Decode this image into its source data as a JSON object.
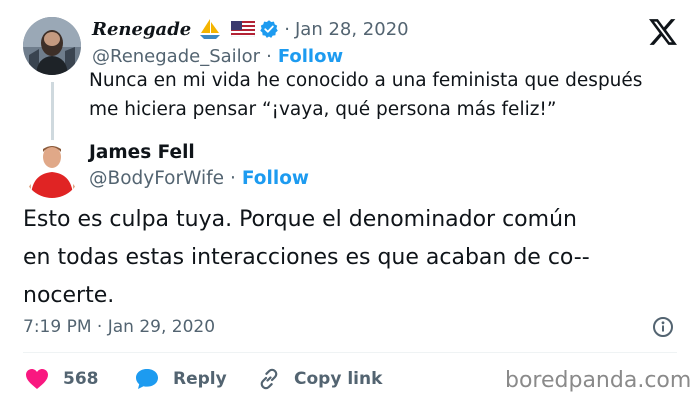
{
  "quoted": {
    "display_name": "Renegade",
    "emoji": [
      "sailboat",
      "us-flag"
    ],
    "verified": true,
    "date": "Jan 28, 2020",
    "handle": "@Renegade_Sailor",
    "follow_label": "Follow",
    "text_line1": "Nunca en mi vida he conocido a una feminista que después",
    "text_line2": "me hiciera pensar “¡vaya, qué persona más feliz!”"
  },
  "reply": {
    "display_name": "James Fell",
    "handle": "@BodyForWife",
    "follow_label": "Follow",
    "text_line1": "Esto es culpa tuya. Porque el denominador común",
    "text_line2": "en todas estas interacciones es que acaban de co--",
    "text_line3": "nocerte.",
    "timestamp": "7:19 PM · Jan 29, 2020"
  },
  "actions": {
    "like_count": "568",
    "reply_label": "Reply",
    "copy_label": "Copy link"
  },
  "watermark": "boredpanda.com",
  "colors": {
    "accent": "#1d9bf0",
    "like": "#f91880",
    "muted": "#536471",
    "text": "#0f1419"
  },
  "icons": [
    "x-logo",
    "verified-icon",
    "info-icon",
    "heart-icon",
    "reply-icon",
    "link-icon"
  ]
}
